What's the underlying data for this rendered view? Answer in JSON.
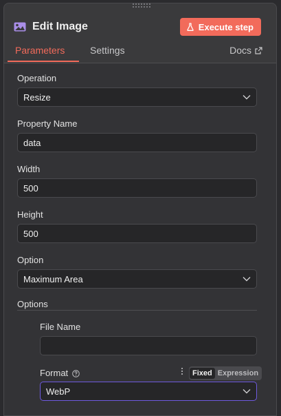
{
  "header": {
    "title": "Edit Image",
    "execute_label": "Execute step"
  },
  "tabs": [
    {
      "label": "Parameters",
      "active": true
    },
    {
      "label": "Settings",
      "active": false
    }
  ],
  "docs_label": "Docs",
  "fields": {
    "operation": {
      "label": "Operation",
      "value": "Resize"
    },
    "property_name": {
      "label": "Property Name",
      "value": "data"
    },
    "width": {
      "label": "Width",
      "value": "500"
    },
    "height": {
      "label": "Height",
      "value": "500"
    },
    "option": {
      "label": "Option",
      "value": "Maximum Area"
    }
  },
  "options": {
    "label": "Options",
    "file_name": {
      "label": "File Name",
      "value": ""
    },
    "format": {
      "label": "Format",
      "value": "WebP",
      "mode_options": [
        "Fixed",
        "Expression"
      ],
      "mode_selected": "Fixed"
    }
  },
  "colors": {
    "accent": "#f26b5b",
    "focus": "#6f5ae0",
    "icon_purple": "#a98ee8"
  }
}
